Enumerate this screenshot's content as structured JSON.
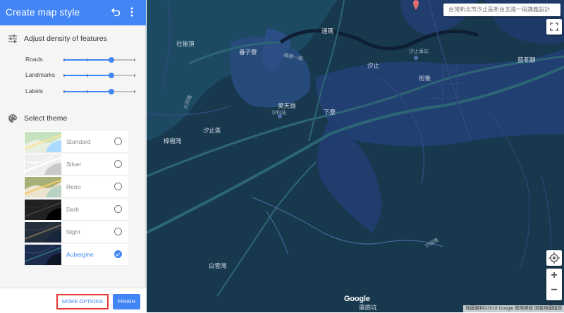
{
  "panel": {
    "title": "Create map style",
    "density_title": "Adjust density of features",
    "sliders": [
      {
        "label": "Roads",
        "value": 0.67
      },
      {
        "label": "Landmarks",
        "value": 0.67
      },
      {
        "label": "Labels",
        "value": 0.67
      }
    ],
    "theme_title": "Select theme",
    "themes": [
      {
        "label": "Standard",
        "selected": false
      },
      {
        "label": "Silver",
        "selected": false
      },
      {
        "label": "Retro",
        "selected": false
      },
      {
        "label": "Dark",
        "selected": false
      },
      {
        "label": "Night",
        "selected": false
      },
      {
        "label": "Aubergine",
        "selected": true
      }
    ],
    "more_options": "MORE OPTIONS",
    "finish": "FINISH"
  },
  "map": {
    "search_text": "台灣新北市汐止區新台五路一段講義設計",
    "labels": {
      "shehouding": "社後頂",
      "tongma": "通碼",
      "banziliao": "番子寮",
      "xizhi_station": "汐止",
      "xizhi_railway": "汐止車站",
      "xiding": "茄苳腳",
      "jiehou": "街後",
      "haotianling": "昊天嶺",
      "xike_station": "汐科站",
      "xiaoliao": "下寮",
      "xizhi_district": "汐止區",
      "zhangshuwan": "樟樹灣",
      "baiyunwan": "白雲灣",
      "kangshikeng": "康誥坑",
      "road1": "福德一路",
      "road2": "大同路",
      "road3": "汐碇路"
    },
    "logo": "Google",
    "attribution": "地圖資料©2018 Google   使用條款   回報地圖錯誤",
    "zoom_in": "+",
    "zoom_out": "−"
  },
  "colors": {
    "accent": "#4285f4",
    "map_bg": "#18384e",
    "highlight": "#e53935"
  }
}
